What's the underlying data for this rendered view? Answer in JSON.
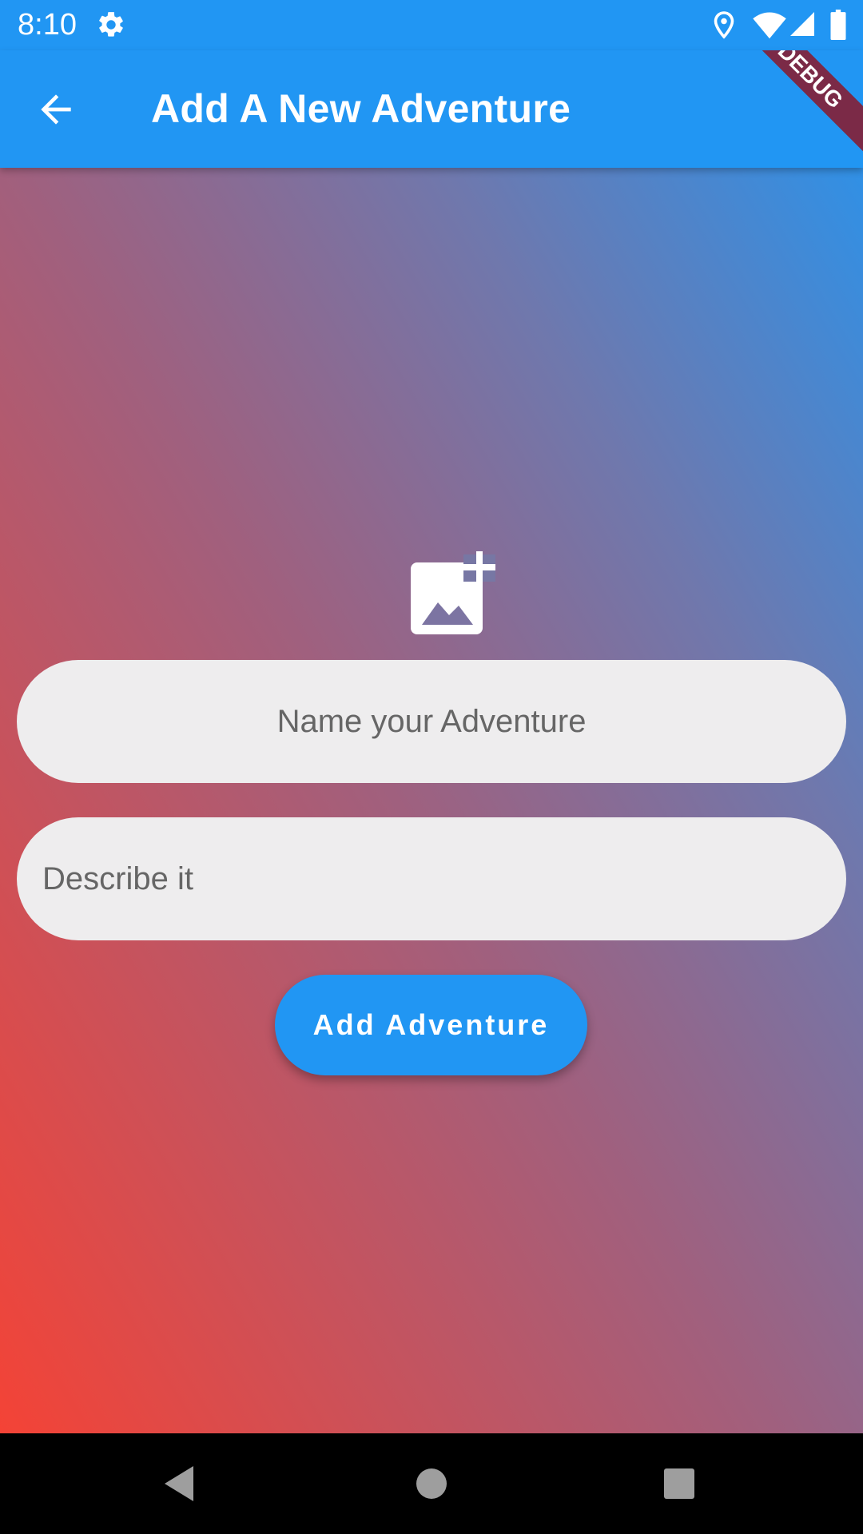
{
  "status_bar": {
    "time": "8:10",
    "icons": [
      "settings-icon",
      "location-icon",
      "wifi-icon",
      "signal-icon",
      "battery-icon"
    ]
  },
  "app_bar": {
    "title": "Add A New Adventure",
    "back_icon": "arrow-back-icon",
    "debug_banner": "DEBUG"
  },
  "form": {
    "add_image_icon": "add-photo-icon",
    "name_placeholder": "Name your Adventure",
    "describe_placeholder": "Describe it",
    "submit_label": "Add Adventure"
  },
  "nav_bar": {
    "icons": [
      "back-triangle-icon",
      "home-circle-icon",
      "recents-square-icon"
    ]
  },
  "colors": {
    "primary": "#2196f3",
    "gradient_start": "#f44336",
    "gradient_end": "#2196f3",
    "input_bg": "#eeedee",
    "debug_banner": "#7b2a47"
  }
}
